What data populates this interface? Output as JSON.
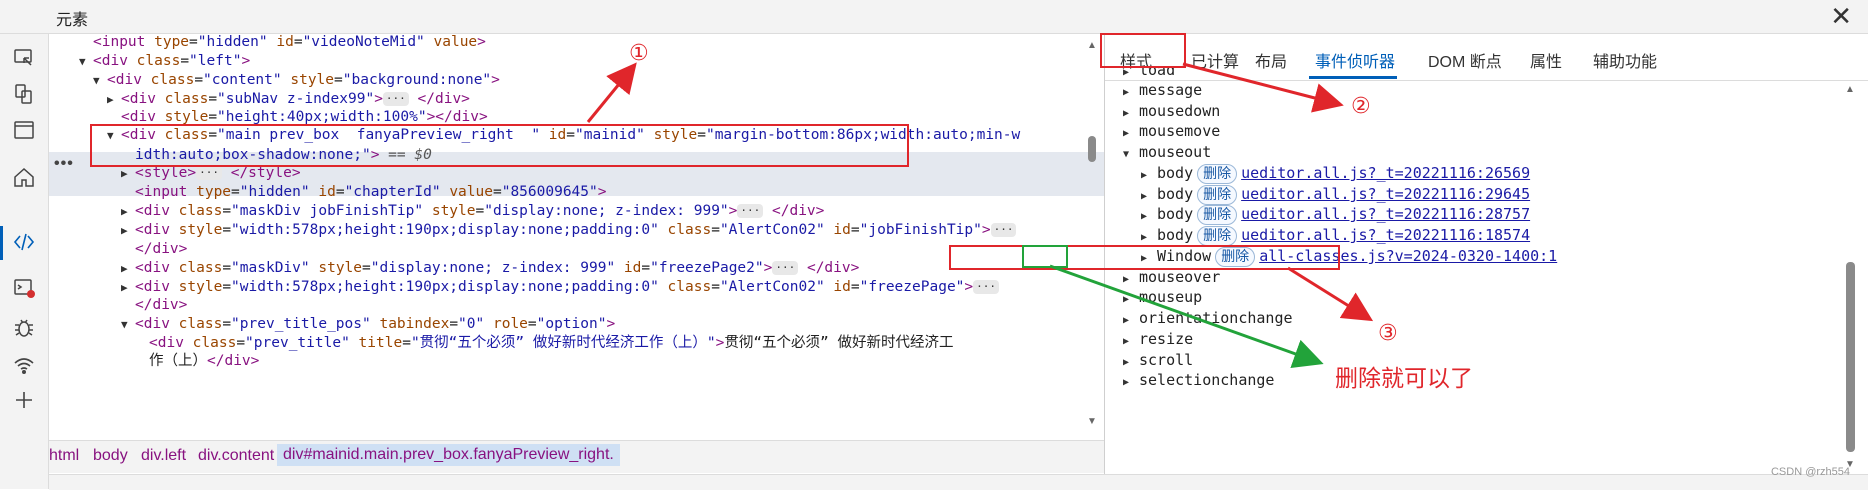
{
  "window": {
    "title": "元素",
    "close": "✕"
  },
  "activity_bar": [
    "inspect-icon",
    "device-icon",
    "window-icon",
    "home-icon",
    "code-icon",
    "console-icon",
    "bug-icon",
    "wifi-icon",
    "plus-icon"
  ],
  "elements": {
    "lines": [
      {
        "indent": 1,
        "tri": "",
        "html": "input_hidden_video"
      },
      {
        "indent": 1,
        "tri": "▼",
        "html": "div_left"
      },
      {
        "indent": 2,
        "tri": "▼",
        "html": "div_content"
      },
      {
        "indent": 3,
        "tri": "▶",
        "html": "div_subnav"
      },
      {
        "indent": 3,
        "tri": "",
        "html": "div_height"
      },
      {
        "indent": 3,
        "tri": "▼",
        "html": "div_main"
      }
    ],
    "text": {
      "l1_tag1": "<input",
      "l1_a1": " type",
      "l1_v1": "\"hidden\"",
      "l1_a2": " id",
      "l1_v2": "\"videoNoteMid\"",
      "l1_a3": " value",
      "l1_end": ">",
      "l2_tag": "<div",
      "l2_a1": " class",
      "l2_v1": "\"left\"",
      "l2_end": ">",
      "l3_tag": "<div",
      "l3_a1": " class",
      "l3_v1": "\"content\"",
      "l3_a2": " style",
      "l3_v2": "\"background:none\"",
      "l3_end": ">",
      "l4_tag": "<div",
      "l4_a1": " class",
      "l4_v1": "\"subNav z-index99\"",
      "l4_end": ">",
      "l4_close": " </div>",
      "l5_tag": "<div",
      "l5_a1": " style",
      "l5_v1": "\"height:40px;width:100%\"",
      "l5_end": "></div>",
      "l6_tag": "<div",
      "l6_a1": " class",
      "l6_v1": "\"main prev_box  fanyaPreview_right  \"",
      "l6_a2": " id",
      "l6_v2": "\"mainid\"",
      "l6_a3": " style",
      "l6_v3": "\"margin-bottom:86px;width:auto;min-w",
      "l7_v": "idth:auto;box-shadow:none;\"",
      "l7_end": ">",
      "l7_dim": " == $0",
      "l8_tag": "<style>",
      "l8_close": " </style>",
      "l9_tag": "<input",
      "l9_a1": " type",
      "l9_v1": "\"hidden\"",
      "l9_a2": " id",
      "l9_v2": "\"chapterId\"",
      "l9_a3": " value",
      "l9_v3": "\"856009645\"",
      "l9_end": ">",
      "l10_tag": "<div",
      "l10_a1": " class",
      "l10_v1": "\"maskDiv jobFinishTip\"",
      "l10_a2": " style",
      "l10_v2": "\"display:none; z-index: 999\"",
      "l10_end": ">",
      "l10_close": " </div>",
      "l11_tag": "<div",
      "l11_a1": " style",
      "l11_v1": "\"width:578px;height:190px;display:none;padding:0\"",
      "l11_a2": " class",
      "l11_v2": "\"AlertCon02\"",
      "l11_a3": " id",
      "l11_v3": "\"jobFinishTip\"",
      "l11_end": ">",
      "l12_close": "</div>",
      "l13_tag": "<div",
      "l13_a1": " class",
      "l13_v1": "\"maskDiv\"",
      "l13_a2": " style",
      "l13_v2": "\"display:none; z-index: 999\"",
      "l13_a3": " id",
      "l13_v3": "\"freezePage2\"",
      "l13_end": ">",
      "l13_close": " </div>",
      "l14_tag": "<div",
      "l14_a1": " style",
      "l14_v1": "\"width:578px;height:190px;display:none;padding:0\"",
      "l14_a2": " class",
      "l14_v2": "\"AlertCon02\"",
      "l14_a3": " id",
      "l14_v3": "\"freezePage\"",
      "l14_end": ">",
      "l15_close": "</div>",
      "l16_tag": "<div",
      "l16_a1": " class",
      "l16_v1": "\"prev_title_pos\"",
      "l16_a2": " tabindex",
      "l16_v2": "\"0\"",
      "l16_a3": " role",
      "l16_v3": "\"option\"",
      "l16_end": ">",
      "l17_tag": "<div",
      "l17_a1": " class",
      "l17_v1": "\"prev_title\"",
      "l17_a2": " title",
      "l17_v2": "\"贯彻“五个必须” 做好新时代经济工作（上）\"",
      "l17_end": ">",
      "l17_txt": "贯彻“五个必须” 做好新时代经济工",
      "l18_txt": "作（上）",
      "l18_close": "</div>",
      "ellipsis": "···",
      "selected_dots": "•••"
    }
  },
  "breadcrumb": [
    "html",
    "body",
    "div.left",
    "div.content",
    "div#mainid.main.prev_box.fanyaPreview_right."
  ],
  "tabs": [
    "样式",
    "已计算",
    "布局",
    "事件侦听器",
    "DOM 断点",
    "属性",
    "辅助功能"
  ],
  "events": {
    "items": [
      "load",
      "message",
      "mousedown",
      "mousemove",
      "mouseout",
      "mouseover",
      "mouseup",
      "orientationchange",
      "resize",
      "scroll",
      "selectionchange"
    ],
    "mouseout_listeners": [
      {
        "node": "body",
        "remove": "删除",
        "source": "ueditor.all.js?_t=20221116:26569"
      },
      {
        "node": "body",
        "remove": "删除",
        "source": "ueditor.all.js?_t=20221116:29645"
      },
      {
        "node": "body",
        "remove": "删除",
        "source": "ueditor.all.js?_t=20221116:28757"
      },
      {
        "node": "body",
        "remove": "删除",
        "source": "ueditor.all.js?_t=20221116:18574"
      },
      {
        "node": "Window",
        "remove": "删除",
        "source": "all-classes.js?v=2024-0320-1400:1"
      }
    ]
  },
  "annotations": {
    "n1": "①",
    "n2": "②",
    "n3": "③",
    "note": "删除就可以了",
    "red": "#e0262b",
    "green": "#22a33a"
  },
  "watermark": "CSDN @rzh554",
  "colors": {
    "tag": "#881280",
    "attr": "#994500",
    "value": "#1a1aa6",
    "accent": "#005fb8"
  }
}
